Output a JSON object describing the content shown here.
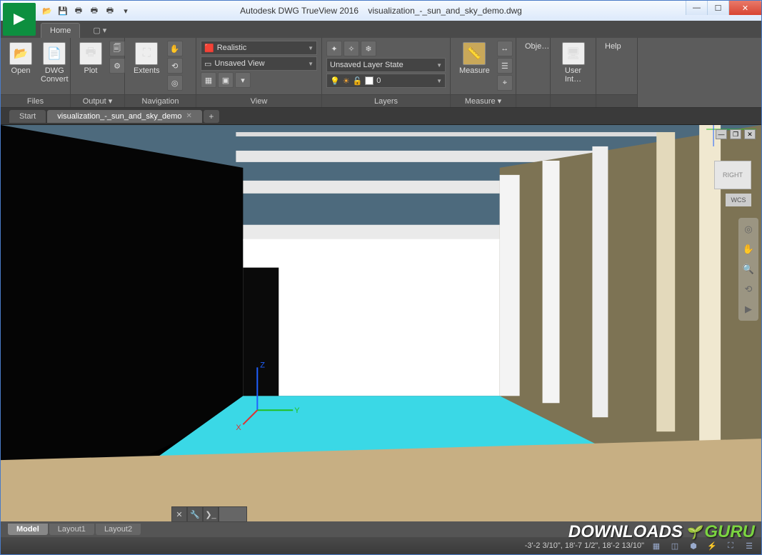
{
  "app": {
    "title_app": "Autodesk DWG TrueView 2016",
    "title_file": "visualization_-_sun_and_sky_demo.dwg"
  },
  "tabs": {
    "home": "Home"
  },
  "ribbon": {
    "files": {
      "label": "Files",
      "open": "Open",
      "dwg_convert": "DWG\nConvert"
    },
    "output": {
      "label": "Output ▾",
      "plot": "Plot"
    },
    "navigation": {
      "label": "Navigation",
      "extents": "Extents"
    },
    "view": {
      "label": "View",
      "visual_style": "Realistic",
      "named_view": "Unsaved View"
    },
    "layers": {
      "label": "Layers",
      "state": "Unsaved Layer State",
      "current": "0"
    },
    "measure": {
      "label": "Measure ▾",
      "measure": "Measure"
    },
    "obj": {
      "label": "Obje…"
    },
    "ui": {
      "label": "User Int…"
    },
    "help": {
      "label": "Help"
    }
  },
  "filetabs": {
    "start": "Start",
    "doc": "visualization_-_sun_and_sky_demo"
  },
  "viewcube": {
    "face": "RIGHT",
    "wcs": "WCS"
  },
  "bottom_tabs": {
    "model": "Model",
    "layout1": "Layout1",
    "layout2": "Layout2"
  },
  "status": {
    "coords": "-3'-2 3/10\", 18'-7 1/2\", 18'-2 13/10\""
  },
  "axes": {
    "x": "X",
    "y": "Y",
    "z": "Z"
  },
  "watermark": {
    "text1": "DOWNLOADS",
    "text2": "GURU"
  }
}
